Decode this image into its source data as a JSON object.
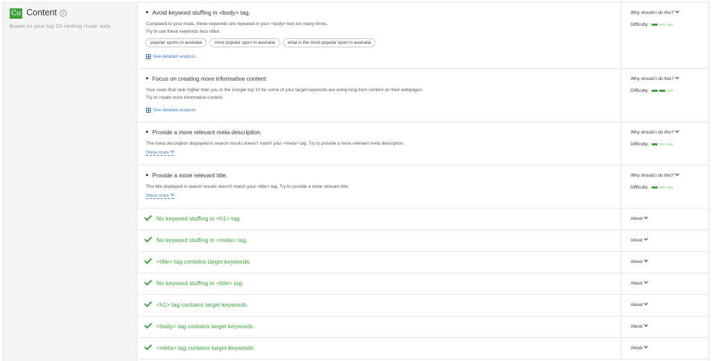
{
  "section": {
    "badge": "Co",
    "title": "Content",
    "info_icon": "info-icon",
    "subtitle": "Based on your top 10-ranking rivals' data"
  },
  "labels": {
    "why": "Why should I do this?",
    "difficulty": "Difficulty:",
    "about": "About",
    "see_analysis": "See detailed analysis",
    "show_more": "Show more"
  },
  "colors": {
    "accent_green": "#3ca33c",
    "link_blue": "#3a7bbf",
    "bar_light": "#c8e6c9"
  },
  "issues": [
    {
      "title": "Avoid keyword stuffing in <body> tag.",
      "desc": [
        "Compared to your rivals, these keywords are repeated in your <body> text too many times.",
        "Try to use these keywords less often."
      ],
      "keywords": [
        "popular sports in australia",
        "most popular sport in australia",
        "what is the most popular sport in australia"
      ],
      "difficulty": 1
    },
    {
      "title": "Focus on creating more informative content.",
      "desc": [
        "Your rivals that rank higher than you in the Google top 10 for some of your target keywords are using long-form content on their webpages.",
        "Try to create more informative content."
      ],
      "difficulty": 2
    },
    {
      "title": "Provide a more relevant meta description.",
      "desc": [
        "The meta description displayed in search results doesn't match your <meta> tag. Try to provide a more relevant meta description."
      ],
      "difficulty": 1
    },
    {
      "title": "Provide a more relevant title.",
      "desc": [
        "The title displayed in search results doesn't match your <title> tag. Try to provide a more relevant title."
      ],
      "difficulty": 1
    }
  ],
  "checks": [
    "No keyword stuffing in <h1> tag.",
    "No keyword stuffing in <meta> tag.",
    "<title> tag contains target keywords.",
    "No keyword stuffing in <title> tag.",
    "<h1> tag contains target keywords.",
    "<body> tag contains target keywords.",
    "<meta> tag contains target keywords"
  ]
}
